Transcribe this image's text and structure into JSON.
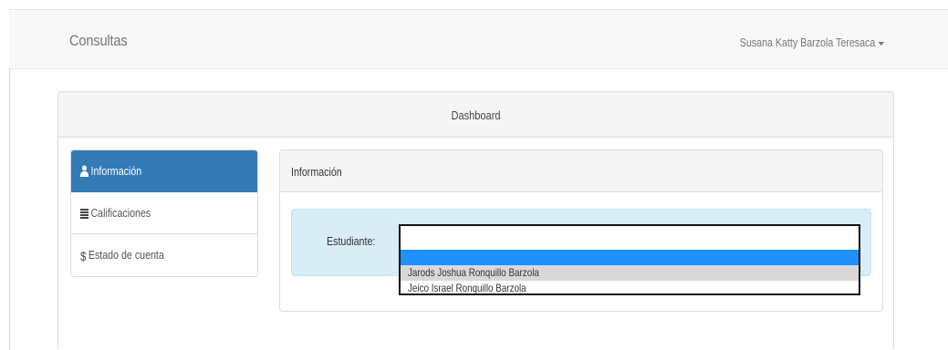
{
  "navbar": {
    "brand": "Consultas",
    "user_name": "Susana Katty Barzola Teresaca"
  },
  "dashboard": {
    "title": "Dashboard"
  },
  "sidebar": {
    "items": [
      {
        "label": "Información",
        "icon": "user-icon",
        "active": true
      },
      {
        "label": "Calificaciones",
        "icon": "list-icon",
        "active": false
      },
      {
        "label": "Estado de cuenta",
        "icon": "dollar-icon",
        "active": false
      }
    ]
  },
  "info_panel": {
    "title": "Información",
    "field_label": "Estudiante:",
    "select": {
      "selected_value": "",
      "options": [
        "Jarods Joshua Ronquillo Barzola",
        "Jeico Israel Ronquillo Barzola"
      ]
    }
  },
  "colors": {
    "primary": "#337ab7",
    "info_bg": "#d9edf7",
    "dropdown_highlight": "#1e90ff"
  }
}
